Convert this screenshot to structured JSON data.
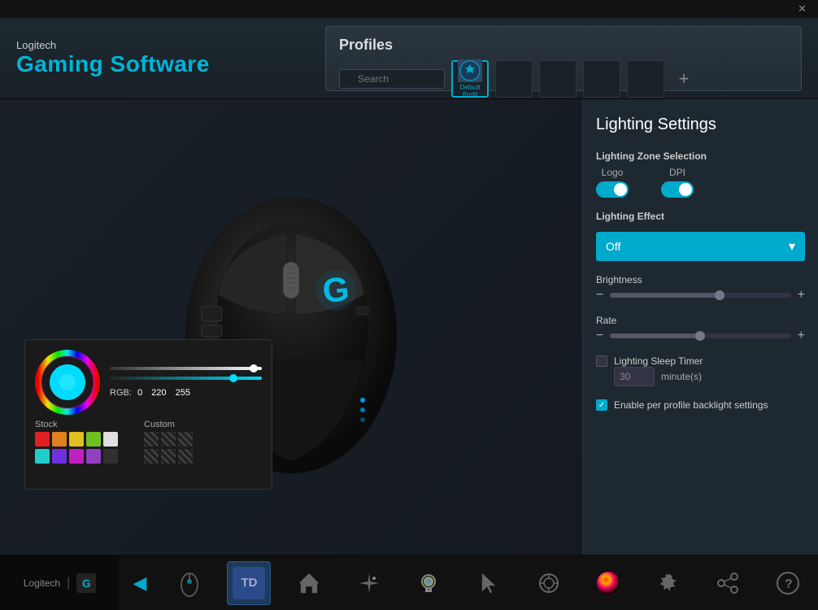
{
  "titlebar": {
    "close_label": "✕"
  },
  "header": {
    "brand": "Logitech",
    "title": "Gaming Software"
  },
  "profiles": {
    "title": "Profiles",
    "search_placeholder": "Search",
    "slots": [
      {
        "id": 1,
        "active": true,
        "label": "Default Profil",
        "has_icon": true
      },
      {
        "id": 2,
        "active": false,
        "label": "",
        "has_icon": false
      },
      {
        "id": 3,
        "active": false,
        "label": "",
        "has_icon": false
      },
      {
        "id": 4,
        "active": false,
        "label": "",
        "has_icon": false
      },
      {
        "id": 5,
        "active": false,
        "label": "",
        "has_icon": false
      }
    ],
    "add_label": "+"
  },
  "lighting": {
    "title": "Lighting Settings",
    "zone_label": "Lighting Zone Selection",
    "logo_label": "Logo",
    "dpi_label": "DPI",
    "effect_label": "Lighting Effect",
    "effect_value": "Off",
    "brightness_label": "Brightness",
    "rate_label": "Rate",
    "sleep_timer_label": "Lighting Sleep Timer",
    "sleep_timer_value": "30",
    "sleep_timer_unit": "minute(s)",
    "backlight_label": "Enable per profile backlight settings",
    "minus": "−",
    "plus": "+"
  },
  "color_picker": {
    "rgb_label": "RGB:",
    "rgb_r": "0",
    "rgb_g": "220",
    "rgb_b": "255",
    "stock_label": "Stock",
    "custom_label": "Custom",
    "stock_colors": [
      "#e02020",
      "#e08020",
      "#e0c020",
      "#70c020",
      "#e0e0e0"
    ],
    "stock_colors2": [
      "#20cccc",
      "#7030e0",
      "#c020c0",
      "#9040c0",
      "#303030"
    ]
  },
  "bottom_nav": {
    "brand": "Logitech",
    "g_logo": "G",
    "items": [
      {
        "id": "mouse",
        "label": "Mouse Device"
      },
      {
        "id": "td",
        "label": "TD Profile",
        "td_text": "TD"
      },
      {
        "id": "home",
        "label": "Home"
      },
      {
        "id": "lights",
        "label": "Lighting"
      },
      {
        "id": "bulb",
        "label": "RGB"
      },
      {
        "id": "cursor",
        "label": "Cursor"
      },
      {
        "id": "target",
        "label": "Target"
      },
      {
        "id": "spectrum",
        "label": "Spectrum"
      },
      {
        "id": "gear",
        "label": "Settings"
      },
      {
        "id": "share",
        "label": "Share"
      },
      {
        "id": "help",
        "label": "Help"
      }
    ]
  }
}
